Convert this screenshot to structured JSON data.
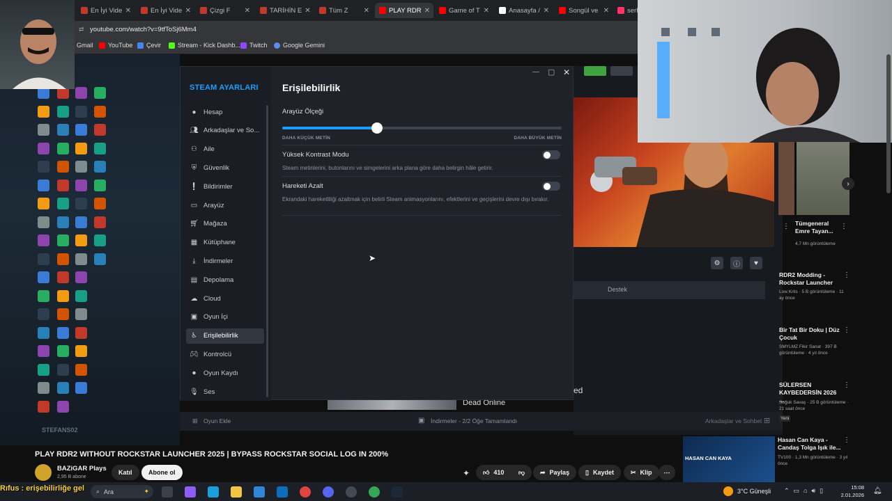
{
  "browser": {
    "tabs": [
      {
        "label": "En İyi Vide",
        "color": "#c0392b"
      },
      {
        "label": "En İyi Vide",
        "color": "#c0392b"
      },
      {
        "label": "Çizgi F",
        "color": "#c0392b"
      },
      {
        "label": "TARİHİN E",
        "color": "#c0392b"
      },
      {
        "label": "Tüm Z",
        "color": "#c0392b"
      },
      {
        "label": "PLAY RDR",
        "color": "#ff0000"
      },
      {
        "label": "Game of T",
        "color": "#ff0000"
      },
      {
        "label": "Anasayfa /",
        "color": "#ffffff"
      },
      {
        "label": "Songül ve",
        "color": "#ff0000"
      },
      {
        "label": "serh",
        "color": "#ff3366"
      }
    ],
    "url": "youtube.com/watch?v=9tfToSj6Mm4",
    "bookmarks": [
      "Gmail",
      "YouTube",
      "Çevir",
      "Stream - Kick Dashb...",
      "Twitch",
      "Google Gemini"
    ]
  },
  "steam": {
    "title": "STEAM AYARLARI",
    "nav": [
      {
        "label": "Hesap",
        "icon": "user-icon"
      },
      {
        "label": "Arkadaşlar ve So...",
        "icon": "friends-icon"
      },
      {
        "label": "Aile",
        "icon": "family-icon"
      },
      {
        "label": "Güvenlik",
        "icon": "shield-icon"
      },
      {
        "label": "Bildirimler",
        "icon": "notification-icon"
      },
      {
        "label": "Arayüz",
        "icon": "monitor-icon"
      },
      {
        "label": "Mağaza",
        "icon": "cart-icon"
      },
      {
        "label": "Kütüphane",
        "icon": "grid-icon"
      },
      {
        "label": "İndirmeler",
        "icon": "download-icon"
      },
      {
        "label": "Depolama",
        "icon": "storage-icon"
      },
      {
        "label": "Cloud",
        "icon": "cloud-icon"
      },
      {
        "label": "Oyun İçi",
        "icon": "ingame-icon"
      },
      {
        "label": "Erişilebilirlik",
        "icon": "accessibility-icon"
      },
      {
        "label": "Kontrolcü",
        "icon": "controller-icon"
      },
      {
        "label": "Oyun Kaydı",
        "icon": "record-icon"
      },
      {
        "label": "Ses",
        "icon": "microphone-icon"
      }
    ],
    "selected_index": 12,
    "content": {
      "title": "Erişilebilirlik",
      "scale_label": "Arayüz Ölçeği",
      "scale_value": 0.34,
      "scale_min_label": "DAHA KÜÇÜK METİN",
      "scale_max_label": "DAHA BÜYÜK METİN",
      "contrast_label": "Yüksek Kontrast Modu",
      "contrast_desc": "Steam metinlerini, butonlarını ve simgelerini arka plana göre daha belirgin hâle getirir.",
      "contrast_on": false,
      "motion_label": "Hareketi Azalt",
      "motion_desc": "Ekrandaki hareketliliği azaltmak için belirli Steam animasyonlarını, efektlerini ve geçişlerini devre dışı bırakır.",
      "motion_on": false
    },
    "footer": {
      "add_game": "Oyun Ekle",
      "downloads": "İndirmeler - 2/2 Öğe Tamamlandı",
      "friends": "Arkadaşlar ve Sohbet"
    },
    "behind": {
      "support": "Destek",
      "dead_online": "Dead Online",
      "ed": "ed"
    }
  },
  "youtube": {
    "video_title": "PLAY RDR2 WITHOUT ROCKSTAR LAUNCHER 2025 | BYPASS ROCKSTAR SOCIAL LOG IN 200%",
    "channel": "BAZiGAR Plays",
    "subs": "2,95 B abone",
    "join": "Katıl",
    "subscribe": "Abone ol",
    "likes": "410",
    "share": "Paylaş",
    "save": "Kaydet",
    "clip": "Klip",
    "sidebar": [
      {
        "title": "Tümgeneral Emre Tayan...",
        "meta": "4,7 Mn görüntüleme"
      },
      {
        "title": "RDR2 Modding - Rockstar Launcher",
        "meta": "Low Krits · 5 B görüntüleme · 11 ay önce"
      },
      {
        "title": "Bir Tat Bir Doku | Düz Çocuk",
        "meta": "SMYLMZ Fikir Sanat · 397 B görüntüleme · 4 yıl önce"
      },
      {
        "title": "SÜLERSEN KAYBEDERSİN 2026 ...",
        "meta": "Soğuk Savaş · 25 B görüntüleme · 21 saat önce",
        "badge": "Yeni"
      },
      {
        "title": "Hasan Can Kaya - Candaş Tolga Işık ile...",
        "meta": "TV100 · 1,3 Mn görüntüleme · 3 yıl önce"
      }
    ],
    "thumb_text": "HASAN CAN KAYA"
  },
  "overlay": {
    "caption": "Rıfus : erişebilirliğe gel"
  },
  "taskbar": {
    "search": "Ara",
    "weather": "3°C Güneşli",
    "time": "15:08",
    "date": "2.01.2026"
  }
}
